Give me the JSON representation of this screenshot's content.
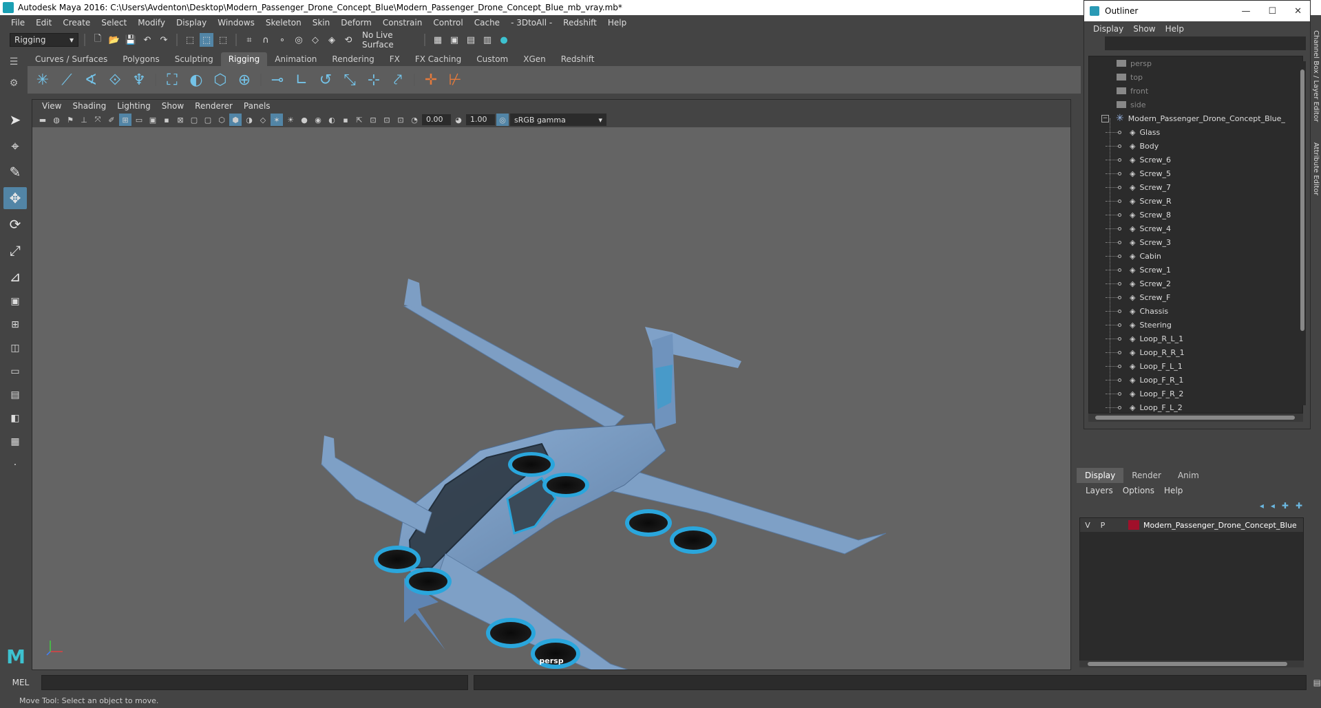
{
  "window": {
    "title": "Autodesk Maya 2016: C:\\Users\\Avdenton\\Desktop\\Modern_Passenger_Drone_Concept_Blue\\Modern_Passenger_Drone_Concept_Blue_mb_vray.mb*"
  },
  "menubar": [
    "File",
    "Edit",
    "Create",
    "Select",
    "Modify",
    "Display",
    "Windows",
    "Skeleton",
    "Skin",
    "Deform",
    "Constrain",
    "Control",
    "Cache",
    "- 3DtoAll -",
    "Redshift",
    "Help"
  ],
  "statusline": {
    "menuset": "Rigging",
    "live_surface": "No Live Surface"
  },
  "shelf": {
    "tabs": [
      "Curves / Surfaces",
      "Polygons",
      "Sculpting",
      "Rigging",
      "Animation",
      "Rendering",
      "FX",
      "FX Caching",
      "Custom",
      "XGen",
      "Redshift"
    ],
    "active_tab": "Rigging"
  },
  "viewport": {
    "menu": [
      "View",
      "Shading",
      "Lighting",
      "Show",
      "Renderer",
      "Panels"
    ],
    "exposure": "0.00",
    "gamma": "1.00",
    "color_space": "sRGB gamma",
    "camera": "persp"
  },
  "outliner": {
    "title": "Outliner",
    "menu": [
      "Display",
      "Show",
      "Help"
    ],
    "cameras": [
      "persp",
      "top",
      "front",
      "side"
    ],
    "root": "Modern_Passenger_Drone_Concept_Blue_",
    "children": [
      "Glass",
      "Body",
      "Screw_6",
      "Screw_5",
      "Screw_7",
      "Screw_R",
      "Screw_8",
      "Screw_4",
      "Screw_3",
      "Cabin",
      "Screw_1",
      "Screw_2",
      "Screw_F",
      "Chassis",
      "Steering",
      "Loop_R_L_1",
      "Loop_R_R_1",
      "Loop_F_L_1",
      "Loop_F_R_1",
      "Loop_F_R_2",
      "Loop_F_L_2"
    ]
  },
  "sidetabs": [
    "Channel Box / Layer Editor",
    "Attribute Editor"
  ],
  "layers": {
    "tabs": [
      "Display",
      "Render",
      "Anim"
    ],
    "active_tab": "Display",
    "menu": [
      "Layers",
      "Options",
      "Help"
    ],
    "rows": [
      {
        "v": "V",
        "p": "P",
        "name": "Modern_Passenger_Drone_Concept_Blue",
        "color": "#a0102a"
      }
    ]
  },
  "commandline": {
    "label": "MEL"
  },
  "helpline": "Move Tool: Select an object to move."
}
